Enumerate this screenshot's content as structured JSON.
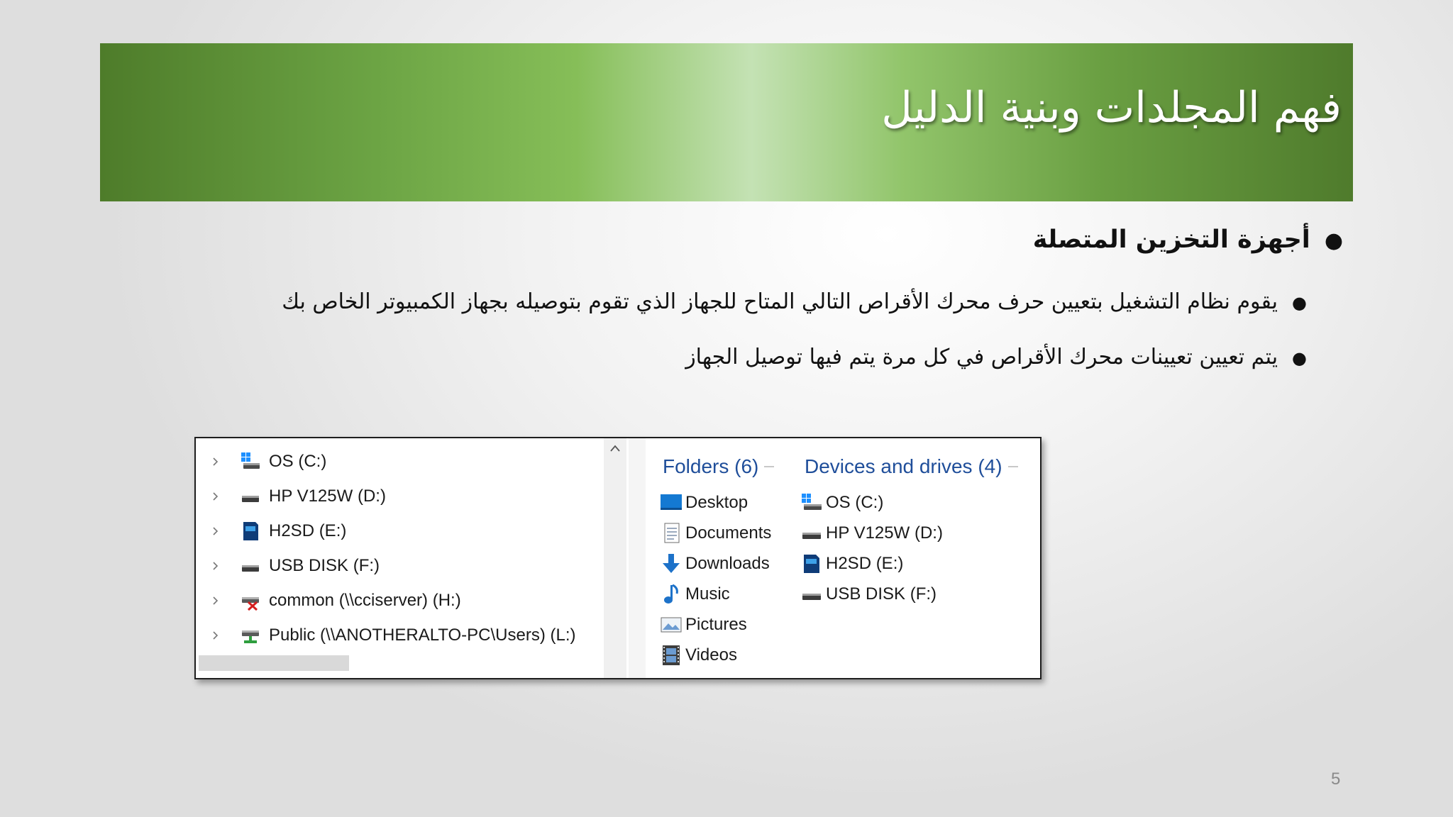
{
  "slide": {
    "title": "فهم المجلدات وبنية الدليل",
    "bullet_main": "أجهزة التخزين المتصلة",
    "sub_bullets": [
      "يقوم نظام التشغيل بتعيين حرف محرك الأقراص التالي المتاح للجهاز الذي تقوم بتوصيله بجهاز الكمبيوتر الخاص بك",
      "يتم تعيين تعيينات محرك الأقراص في كل مرة يتم فيها توصيل الجهاز"
    ],
    "page_number": "5"
  },
  "explorer": {
    "nav_items": [
      {
        "label": "OS (C:)",
        "icon": "windows-drive-icon"
      },
      {
        "label": "HP V125W (D:)",
        "icon": "usb-drive-icon"
      },
      {
        "label": "H2SD (E:)",
        "icon": "sd-card-icon"
      },
      {
        "label": "USB DISK (F:)",
        "icon": "usb-drive-icon"
      },
      {
        "label": "common (\\\\cciserver) (H:)",
        "icon": "disconnected-network-drive-icon"
      },
      {
        "label": "Public (\\\\ANOTHERALTO-PC\\Users) (L:)",
        "icon": "network-drive-icon"
      }
    ],
    "folders_header": "Folders (6)",
    "folders": [
      {
        "label": "Desktop",
        "icon": "desktop-icon"
      },
      {
        "label": "Documents",
        "icon": "documents-icon"
      },
      {
        "label": "Downloads",
        "icon": "downloads-icon"
      },
      {
        "label": "Music",
        "icon": "music-icon"
      },
      {
        "label": "Pictures",
        "icon": "pictures-icon"
      },
      {
        "label": "Videos",
        "icon": "videos-icon"
      }
    ],
    "drives_header": "Devices and drives (4)",
    "drives": [
      {
        "label": "OS (C:)",
        "icon": "windows-drive-icon"
      },
      {
        "label": "HP V125W (D:)",
        "icon": "usb-drive-icon"
      },
      {
        "label": "H2SD (E:)",
        "icon": "sd-card-icon"
      },
      {
        "label": "USB DISK (F:)",
        "icon": "usb-drive-icon"
      }
    ]
  },
  "colors": {
    "banner_dark": "#4e7c2a",
    "banner_light": "#c4e2b4",
    "header_blue": "#1f4e9a"
  }
}
